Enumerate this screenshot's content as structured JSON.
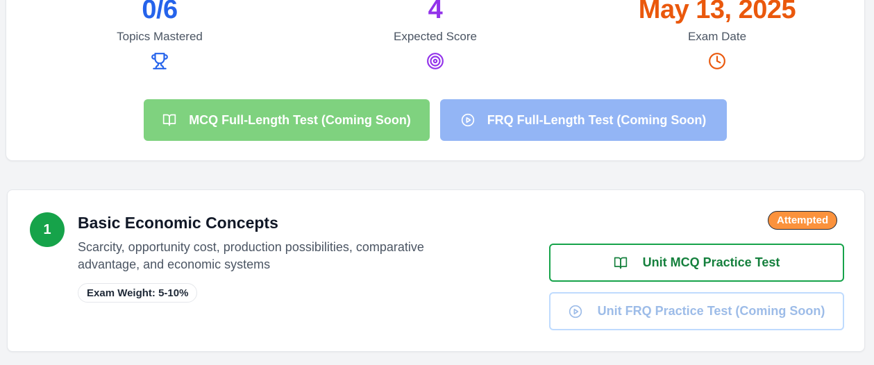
{
  "stats": {
    "topics": {
      "value": "0/6",
      "label": "Topics Mastered",
      "icon": "trophy-icon",
      "color": "#2563eb"
    },
    "score": {
      "value": "4",
      "label": "Expected Score",
      "icon": "target-icon",
      "color": "#9333ea"
    },
    "exam": {
      "value": "May 13, 2025",
      "label": "Exam Date",
      "icon": "clock-icon",
      "color": "#ea580c"
    }
  },
  "actions": {
    "mcq_full": {
      "label": "MCQ Full-Length Test (Coming Soon)",
      "icon": "book-open-icon",
      "color": "#7fd27f"
    },
    "frq_full": {
      "label": "FRQ Full-Length Test (Coming Soon)",
      "icon": "play-circle-icon",
      "color": "#93b5f5"
    }
  },
  "unit": {
    "number": "1",
    "title": "Basic Economic Concepts",
    "description": "Scarcity, opportunity cost, production possibilities, comparative advantage, and economic systems",
    "weight": "Exam Weight: 5-10%",
    "status": "Attempted",
    "mcq_label": "Unit MCQ Practice Test",
    "frq_label": "Unit FRQ Practice Test (Coming Soon)"
  }
}
